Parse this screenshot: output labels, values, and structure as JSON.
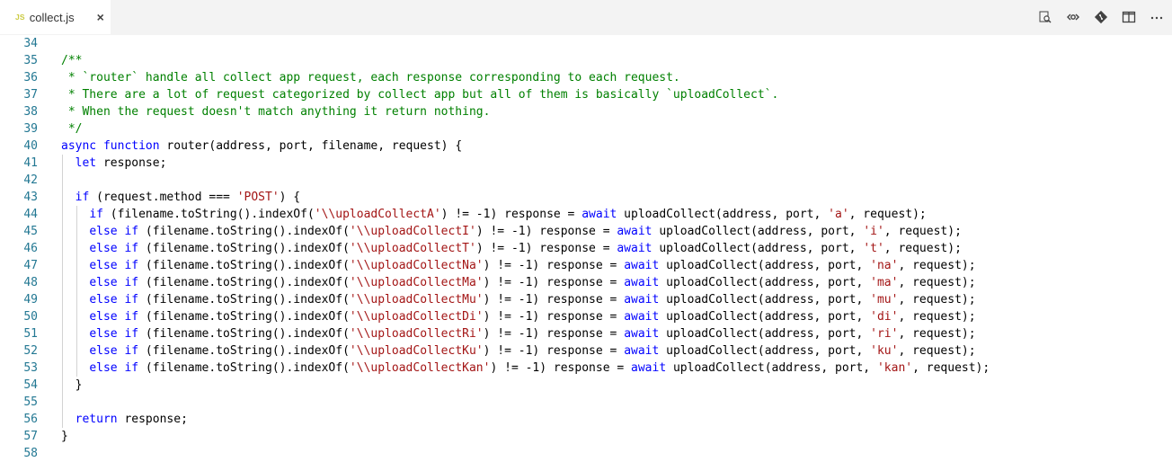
{
  "tab": {
    "icon_text": "JS",
    "filename": "collect.js",
    "close": "×"
  },
  "actions": [
    "open-preview-icon",
    "go-to-changes-icon",
    "git-compare-icon",
    "split-editor-icon",
    "more-actions-icon"
  ],
  "lines": [
    {
      "n": "34",
      "indent": 0,
      "tokens": []
    },
    {
      "n": "35",
      "indent": 0,
      "tokens": [
        [
          "c",
          "/**"
        ]
      ]
    },
    {
      "n": "36",
      "indent": 0,
      "tokens": [
        [
          "c",
          " * `router` handle all collect app request, each response corresponding to each request."
        ]
      ]
    },
    {
      "n": "37",
      "indent": 0,
      "tokens": [
        [
          "c",
          " * There are a lot of request categorized by collect app but all of them is basically `uploadCollect`."
        ]
      ]
    },
    {
      "n": "38",
      "indent": 0,
      "tokens": [
        [
          "c",
          " * When the request doesn't match anything it return nothing."
        ]
      ]
    },
    {
      "n": "39",
      "indent": 0,
      "tokens": [
        [
          "c",
          " */"
        ]
      ]
    },
    {
      "n": "40",
      "indent": 0,
      "tokens": [
        [
          "k",
          "async"
        ],
        [
          "t",
          " "
        ],
        [
          "k",
          "function"
        ],
        [
          "t",
          " router(address, port, filename, request) {"
        ]
      ]
    },
    {
      "n": "41",
      "indent": 1,
      "tokens": [
        [
          "t",
          "  "
        ],
        [
          "k",
          "let"
        ],
        [
          "t",
          " response;"
        ]
      ]
    },
    {
      "n": "42",
      "indent": 1,
      "tokens": []
    },
    {
      "n": "43",
      "indent": 1,
      "tokens": [
        [
          "t",
          "  "
        ],
        [
          "k",
          "if"
        ],
        [
          "t",
          " (request.method === "
        ],
        [
          "s",
          "'POST'"
        ],
        [
          "t",
          ") {"
        ]
      ]
    },
    {
      "n": "44",
      "indent": 2,
      "tokens": [
        [
          "t",
          "    "
        ],
        [
          "k",
          "if"
        ],
        [
          "t",
          " (filename.toString().indexOf("
        ],
        [
          "s",
          "'\\\\uploadCollectA'"
        ],
        [
          "t",
          ") != -1) response = "
        ],
        [
          "k",
          "await"
        ],
        [
          "t",
          " uploadCollect(address, port, "
        ],
        [
          "s",
          "'a'"
        ],
        [
          "t",
          ", request);"
        ]
      ]
    },
    {
      "n": "45",
      "indent": 2,
      "tokens": [
        [
          "t",
          "    "
        ],
        [
          "k",
          "else"
        ],
        [
          "t",
          " "
        ],
        [
          "k",
          "if"
        ],
        [
          "t",
          " (filename.toString().indexOf("
        ],
        [
          "s",
          "'\\\\uploadCollectI'"
        ],
        [
          "t",
          ") != -1) response = "
        ],
        [
          "k",
          "await"
        ],
        [
          "t",
          " uploadCollect(address, port, "
        ],
        [
          "s",
          "'i'"
        ],
        [
          "t",
          ", request);"
        ]
      ]
    },
    {
      "n": "46",
      "indent": 2,
      "tokens": [
        [
          "t",
          "    "
        ],
        [
          "k",
          "else"
        ],
        [
          "t",
          " "
        ],
        [
          "k",
          "if"
        ],
        [
          "t",
          " (filename.toString().indexOf("
        ],
        [
          "s",
          "'\\\\uploadCollectT'"
        ],
        [
          "t",
          ") != -1) response = "
        ],
        [
          "k",
          "await"
        ],
        [
          "t",
          " uploadCollect(address, port, "
        ],
        [
          "s",
          "'t'"
        ],
        [
          "t",
          ", request);"
        ]
      ]
    },
    {
      "n": "47",
      "indent": 2,
      "tokens": [
        [
          "t",
          "    "
        ],
        [
          "k",
          "else"
        ],
        [
          "t",
          " "
        ],
        [
          "k",
          "if"
        ],
        [
          "t",
          " (filename.toString().indexOf("
        ],
        [
          "s",
          "'\\\\uploadCollectNa'"
        ],
        [
          "t",
          ") != -1) response = "
        ],
        [
          "k",
          "await"
        ],
        [
          "t",
          " uploadCollect(address, port, "
        ],
        [
          "s",
          "'na'"
        ],
        [
          "t",
          ", request);"
        ]
      ]
    },
    {
      "n": "48",
      "indent": 2,
      "tokens": [
        [
          "t",
          "    "
        ],
        [
          "k",
          "else"
        ],
        [
          "t",
          " "
        ],
        [
          "k",
          "if"
        ],
        [
          "t",
          " (filename.toString().indexOf("
        ],
        [
          "s",
          "'\\\\uploadCollectMa'"
        ],
        [
          "t",
          ") != -1) response = "
        ],
        [
          "k",
          "await"
        ],
        [
          "t",
          " uploadCollect(address, port, "
        ],
        [
          "s",
          "'ma'"
        ],
        [
          "t",
          ", request);"
        ]
      ]
    },
    {
      "n": "49",
      "indent": 2,
      "tokens": [
        [
          "t",
          "    "
        ],
        [
          "k",
          "else"
        ],
        [
          "t",
          " "
        ],
        [
          "k",
          "if"
        ],
        [
          "t",
          " (filename.toString().indexOf("
        ],
        [
          "s",
          "'\\\\uploadCollectMu'"
        ],
        [
          "t",
          ") != -1) response = "
        ],
        [
          "k",
          "await"
        ],
        [
          "t",
          " uploadCollect(address, port, "
        ],
        [
          "s",
          "'mu'"
        ],
        [
          "t",
          ", request);"
        ]
      ]
    },
    {
      "n": "50",
      "indent": 2,
      "tokens": [
        [
          "t",
          "    "
        ],
        [
          "k",
          "else"
        ],
        [
          "t",
          " "
        ],
        [
          "k",
          "if"
        ],
        [
          "t",
          " (filename.toString().indexOf("
        ],
        [
          "s",
          "'\\\\uploadCollectDi'"
        ],
        [
          "t",
          ") != -1) response = "
        ],
        [
          "k",
          "await"
        ],
        [
          "t",
          " uploadCollect(address, port, "
        ],
        [
          "s",
          "'di'"
        ],
        [
          "t",
          ", request);"
        ]
      ]
    },
    {
      "n": "51",
      "indent": 2,
      "tokens": [
        [
          "t",
          "    "
        ],
        [
          "k",
          "else"
        ],
        [
          "t",
          " "
        ],
        [
          "k",
          "if"
        ],
        [
          "t",
          " (filename.toString().indexOf("
        ],
        [
          "s",
          "'\\\\uploadCollectRi'"
        ],
        [
          "t",
          ") != -1) response = "
        ],
        [
          "k",
          "await"
        ],
        [
          "t",
          " uploadCollect(address, port, "
        ],
        [
          "s",
          "'ri'"
        ],
        [
          "t",
          ", request);"
        ]
      ]
    },
    {
      "n": "52",
      "indent": 2,
      "tokens": [
        [
          "t",
          "    "
        ],
        [
          "k",
          "else"
        ],
        [
          "t",
          " "
        ],
        [
          "k",
          "if"
        ],
        [
          "t",
          " (filename.toString().indexOf("
        ],
        [
          "s",
          "'\\\\uploadCollectKu'"
        ],
        [
          "t",
          ") != -1) response = "
        ],
        [
          "k",
          "await"
        ],
        [
          "t",
          " uploadCollect(address, port, "
        ],
        [
          "s",
          "'ku'"
        ],
        [
          "t",
          ", request);"
        ]
      ]
    },
    {
      "n": "53",
      "indent": 2,
      "tokens": [
        [
          "t",
          "    "
        ],
        [
          "k",
          "else"
        ],
        [
          "t",
          " "
        ],
        [
          "k",
          "if"
        ],
        [
          "t",
          " (filename.toString().indexOf("
        ],
        [
          "s",
          "'\\\\uploadCollectKan'"
        ],
        [
          "t",
          ") != -1) response = "
        ],
        [
          "k",
          "await"
        ],
        [
          "t",
          " uploadCollect(address, port, "
        ],
        [
          "s",
          "'kan'"
        ],
        [
          "t",
          ", request);"
        ]
      ]
    },
    {
      "n": "54",
      "indent": 1,
      "tokens": [
        [
          "t",
          "  }"
        ]
      ]
    },
    {
      "n": "55",
      "indent": 1,
      "tokens": []
    },
    {
      "n": "56",
      "indent": 1,
      "tokens": [
        [
          "t",
          "  "
        ],
        [
          "k",
          "return"
        ],
        [
          "t",
          " response;"
        ]
      ]
    },
    {
      "n": "57",
      "indent": 0,
      "tokens": [
        [
          "t",
          "}"
        ]
      ]
    },
    {
      "n": "58",
      "indent": 0,
      "tokens": []
    }
  ]
}
